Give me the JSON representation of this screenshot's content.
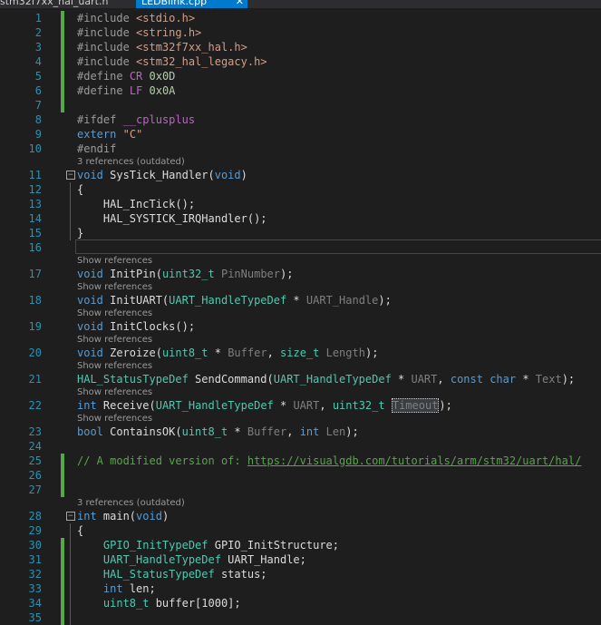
{
  "tabs": [
    {
      "label": "stm32f7xx_hal_uart.h",
      "active": false
    },
    {
      "label": "LEDBlink.cpp",
      "active": true,
      "close_icon": "close-icon"
    }
  ],
  "codelens": {
    "outdated": "3 references (outdated)",
    "show": "Show references"
  },
  "lines": [
    {
      "n": "1",
      "t": "#include <stdio.h>"
    },
    {
      "n": "2",
      "t": "#include <string.h>"
    },
    {
      "n": "3",
      "t": "#include <stm32f7xx_hal.h>"
    },
    {
      "n": "4",
      "t": "#include <stm32_hal_legacy.h>"
    },
    {
      "n": "5",
      "t": "#define CR 0x0D"
    },
    {
      "n": "6",
      "t": "#define LF 0x0A"
    },
    {
      "n": "7",
      "t": ""
    },
    {
      "n": "8",
      "t": "#ifdef __cplusplus"
    },
    {
      "n": "9",
      "t": "extern \"C\""
    },
    {
      "n": "10",
      "t": "#endif"
    },
    {
      "n": "11",
      "t": "void SysTick_Handler(void)"
    },
    {
      "n": "12",
      "t": "{"
    },
    {
      "n": "13",
      "t": "    HAL_IncTick();"
    },
    {
      "n": "14",
      "t": "    HAL_SYSTICK_IRQHandler();"
    },
    {
      "n": "15",
      "t": "}"
    },
    {
      "n": "16",
      "t": ""
    },
    {
      "n": "17",
      "t": "void InitPin(uint32_t PinNumber);"
    },
    {
      "n": "18",
      "t": "void InitUART(UART_HandleTypeDef * UART_Handle);"
    },
    {
      "n": "19",
      "t": "void InitClocks();"
    },
    {
      "n": "20",
      "t": "void Zeroize(uint8_t * Buffer, size_t Length);"
    },
    {
      "n": "21",
      "t": "HAL_StatusTypeDef SendCommand(UART_HandleTypeDef * UART, const char * Text);"
    },
    {
      "n": "22",
      "t": "int Receive(UART_HandleTypeDef * UART, uint32_t Timeout);"
    },
    {
      "n": "23",
      "t": "bool ContainsOK(uint8_t * Buffer, int Len);"
    },
    {
      "n": "24",
      "t": ""
    },
    {
      "n": "25",
      "t": "// A modified version of: https://visualgdb.com/tutorials/arm/stm32/uart/hal/"
    },
    {
      "n": "26",
      "t": ""
    },
    {
      "n": "27",
      "t": ""
    },
    {
      "n": "28",
      "t": "int main(void)"
    },
    {
      "n": "29",
      "t": "{"
    },
    {
      "n": "30",
      "t": "    GPIO_InitTypeDef GPIO_InitStructure;"
    },
    {
      "n": "31",
      "t": "    UART_HandleTypeDef UART_Handle;"
    },
    {
      "n": "32",
      "t": "    HAL_StatusTypeDef status;"
    },
    {
      "n": "33",
      "t": "    int len;"
    },
    {
      "n": "34",
      "t": "    uint8_t buffer[1000];"
    },
    {
      "n": "35",
      "t": ""
    }
  ],
  "tokens": {
    "l1": [
      "#include",
      " ",
      "<stdio.h>"
    ],
    "l2": [
      "#include",
      " ",
      "<string.h>"
    ],
    "l3": [
      "#include",
      " ",
      "<stm32f7xx_hal.h>"
    ],
    "l4": [
      "#include",
      " ",
      "<stm32_hal_legacy.h>"
    ],
    "l5": [
      "#define",
      " ",
      "CR",
      " ",
      "0x0D"
    ],
    "l6": [
      "#define",
      " ",
      "LF",
      " ",
      "0x0A"
    ],
    "l8": [
      "#ifdef",
      " ",
      "__cplusplus"
    ],
    "l9": [
      "extern",
      " ",
      "\"C\""
    ],
    "l10": [
      "#endif"
    ],
    "l11": [
      "void",
      " SysTick_Handler(",
      "void",
      ")"
    ],
    "l12": [
      "{"
    ],
    "l13": [
      "    HAL_IncTick();"
    ],
    "l14": [
      "    HAL_SYSTICK_IRQHandler();"
    ],
    "l15": [
      "}"
    ],
    "l17": [
      "void",
      " InitPin(",
      "uint32_t",
      " ",
      "PinNumber",
      ");"
    ],
    "l18": [
      "void",
      " InitUART(",
      "UART_HandleTypeDef",
      " * ",
      "UART_Handle",
      ");"
    ],
    "l19": [
      "void",
      " InitClocks();"
    ],
    "l20": [
      "void",
      " Zeroize(",
      "uint8_t",
      " * ",
      "Buffer",
      ", ",
      "size_t",
      " ",
      "Length",
      ");"
    ],
    "l21": [
      "HAL_StatusTypeDef",
      " SendCommand(",
      "UART_HandleTypeDef",
      " * ",
      "UART",
      ", ",
      "const",
      " ",
      "char",
      " * ",
      "Text",
      ");"
    ],
    "l22": [
      "int",
      " Receive(",
      "UART_HandleTypeDef",
      " * ",
      "UART",
      ", ",
      "uint32_t",
      " ",
      "Timeout",
      ");"
    ],
    "l23": [
      "bool",
      " ContainsOK(",
      "uint8_t",
      " * ",
      "Buffer",
      ", ",
      "int",
      " ",
      "Len",
      ");"
    ],
    "l25": [
      "// A modified version of: ",
      "https://visualgdb.com/tutorials/arm/stm32/uart/hal/"
    ],
    "l28": [
      "int",
      " main(",
      "void",
      ")"
    ],
    "l29": [
      "{"
    ],
    "l30": [
      "    ",
      "GPIO_InitTypeDef",
      " GPIO_InitStructure;"
    ],
    "l31": [
      "    ",
      "UART_HandleTypeDef",
      " UART_Handle;"
    ],
    "l32": [
      "    ",
      "HAL_StatusTypeDef",
      " status;"
    ],
    "l33": [
      "    ",
      "int",
      " len;"
    ],
    "l34": [
      "    ",
      "uint8_t",
      " buffer[1000];"
    ]
  },
  "colors": {
    "background": "#1e1e1e",
    "line_number": "#2b91af",
    "keyword": "#569cd6",
    "type": "#4ec9b0",
    "string": "#d69d85",
    "macro": "#bd63c5",
    "comment": "#57a64a",
    "tab_active": "#007acc"
  }
}
